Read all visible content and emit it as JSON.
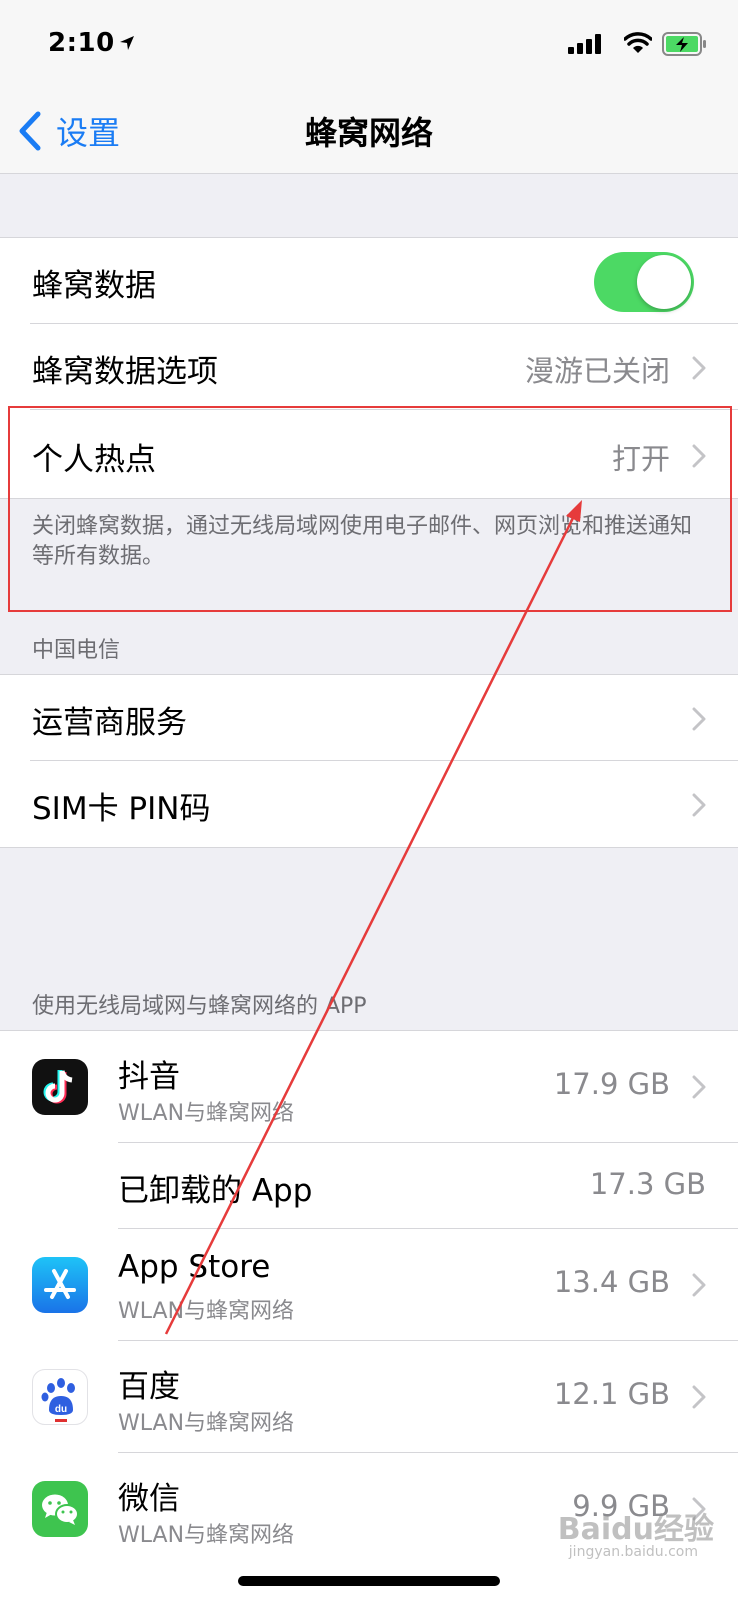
{
  "status": {
    "time": "2:10"
  },
  "nav": {
    "back_label": "设置",
    "title": "蜂窝网络"
  },
  "cellular_group": {
    "cellular_data": {
      "label": "蜂窝数据",
      "enabled": true
    },
    "data_options": {
      "label": "蜂窝数据选项",
      "value": "漫游已关闭"
    },
    "hotspot": {
      "label": "个人热点",
      "value": "打开"
    }
  },
  "cellular_footer": "关闭蜂窝数据，通过无线局域网使用电子邮件、网页浏览和推送通知等所有数据。",
  "carrier": {
    "header": "中国电信",
    "services": {
      "label": "运营商服务"
    },
    "sim_pin": {
      "label": "SIM卡 PIN码"
    }
  },
  "apps_header": "使用无线局域网与蜂窝网络的 APP",
  "apps": [
    {
      "name": "抖音",
      "sub": "WLAN与蜂窝网络",
      "size": "17.9 GB",
      "icon": "tiktok-icon"
    },
    {
      "name": "已卸载的 App",
      "sub": "",
      "size": "17.3 GB",
      "icon": ""
    },
    {
      "name": "App Store",
      "sub": "WLAN与蜂窝网络",
      "size": "13.4 GB",
      "icon": "app-store-icon"
    },
    {
      "name": "百度",
      "sub": "WLAN与蜂窝网络",
      "size": "12.1 GB",
      "icon": "baidu-icon"
    },
    {
      "name": "微信",
      "sub": "WLAN与蜂窝网络",
      "size": "9.9 GB",
      "icon": "wechat-icon"
    }
  ],
  "watermark": {
    "brand": "Baidu经验",
    "url": "jingyan.baidu.com"
  },
  "colors": {
    "accent": "#1a7cf4",
    "toggle_on": "#4cd964",
    "annotation": "#e63b3b"
  }
}
